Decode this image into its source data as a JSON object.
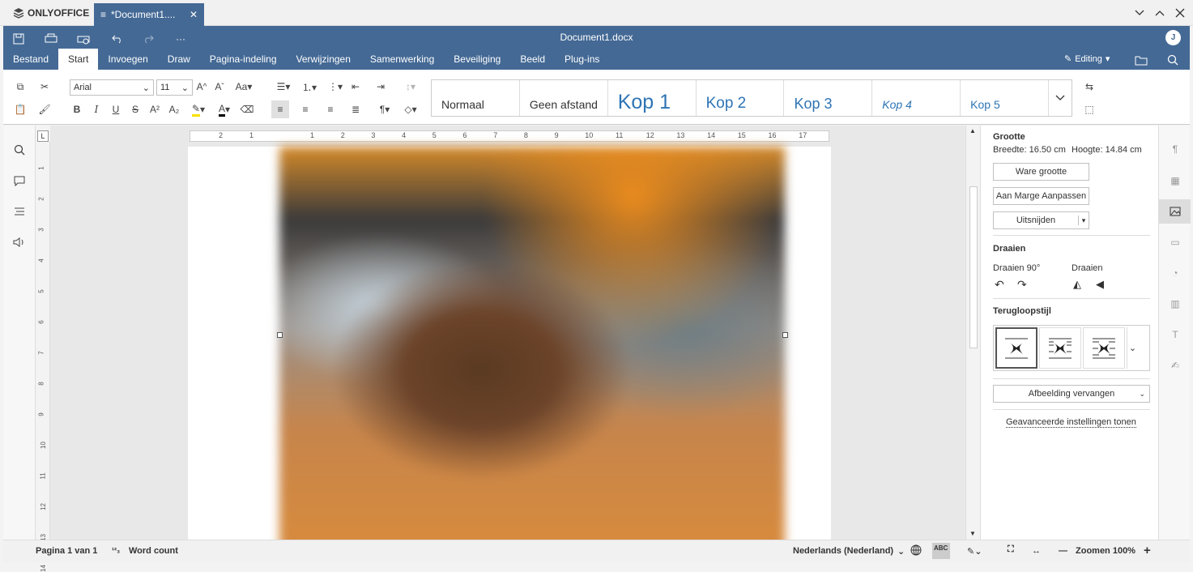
{
  "app": {
    "brand": "ONLYOFFICE",
    "tab_title": "*Document1....",
    "doc_title": "Document1.docx",
    "user_initial": "J",
    "accent": "#446995"
  },
  "menu": {
    "tabs": [
      "Bestand",
      "Start",
      "Invoegen",
      "Draw",
      "Pagina-indeling",
      "Verwijzingen",
      "Samenwerking",
      "Beveiliging",
      "Beeld",
      "Plug-ins"
    ],
    "mode": "Editing"
  },
  "toolbar": {
    "font_name": "Arial",
    "font_size": "11",
    "styles": [
      "Normaal",
      "Geen afstand",
      "Kop 1",
      "Kop 2",
      "Kop 3",
      "Kop 4",
      "Kop 5"
    ]
  },
  "ruler": {
    "h_marks": [
      "2",
      "1",
      "1",
      "2",
      "3",
      "4",
      "5",
      "6",
      "7",
      "8",
      "9",
      "10",
      "11",
      "12",
      "13",
      "14",
      "15",
      "16",
      "17"
    ],
    "v_marks": [
      "1",
      "2",
      "3",
      "4",
      "5",
      "6",
      "7",
      "8",
      "9",
      "10",
      "11",
      "12",
      "13",
      "14"
    ]
  },
  "panel": {
    "size_title": "Grootte",
    "width_label": "Breedte: 16.50 cm",
    "height_label": "Hoogte: 14.84 cm",
    "actual_size": "Ware grootte",
    "fit_margin": "Aan Marge Aanpassen",
    "crop": "Uitsnijden",
    "rotate_title": "Draaien",
    "rotate90": "Draaien 90°",
    "flip": "Draaien",
    "wrap_title": "Terugloopstijl",
    "replace": "Afbeelding vervangen",
    "advanced": "Geavanceerde instellingen tonen"
  },
  "status": {
    "page": "Pagina 1 van 1",
    "word_count": "Word count",
    "language": "Nederlands (Nederland)",
    "zoom": "Zoomen 100%"
  }
}
